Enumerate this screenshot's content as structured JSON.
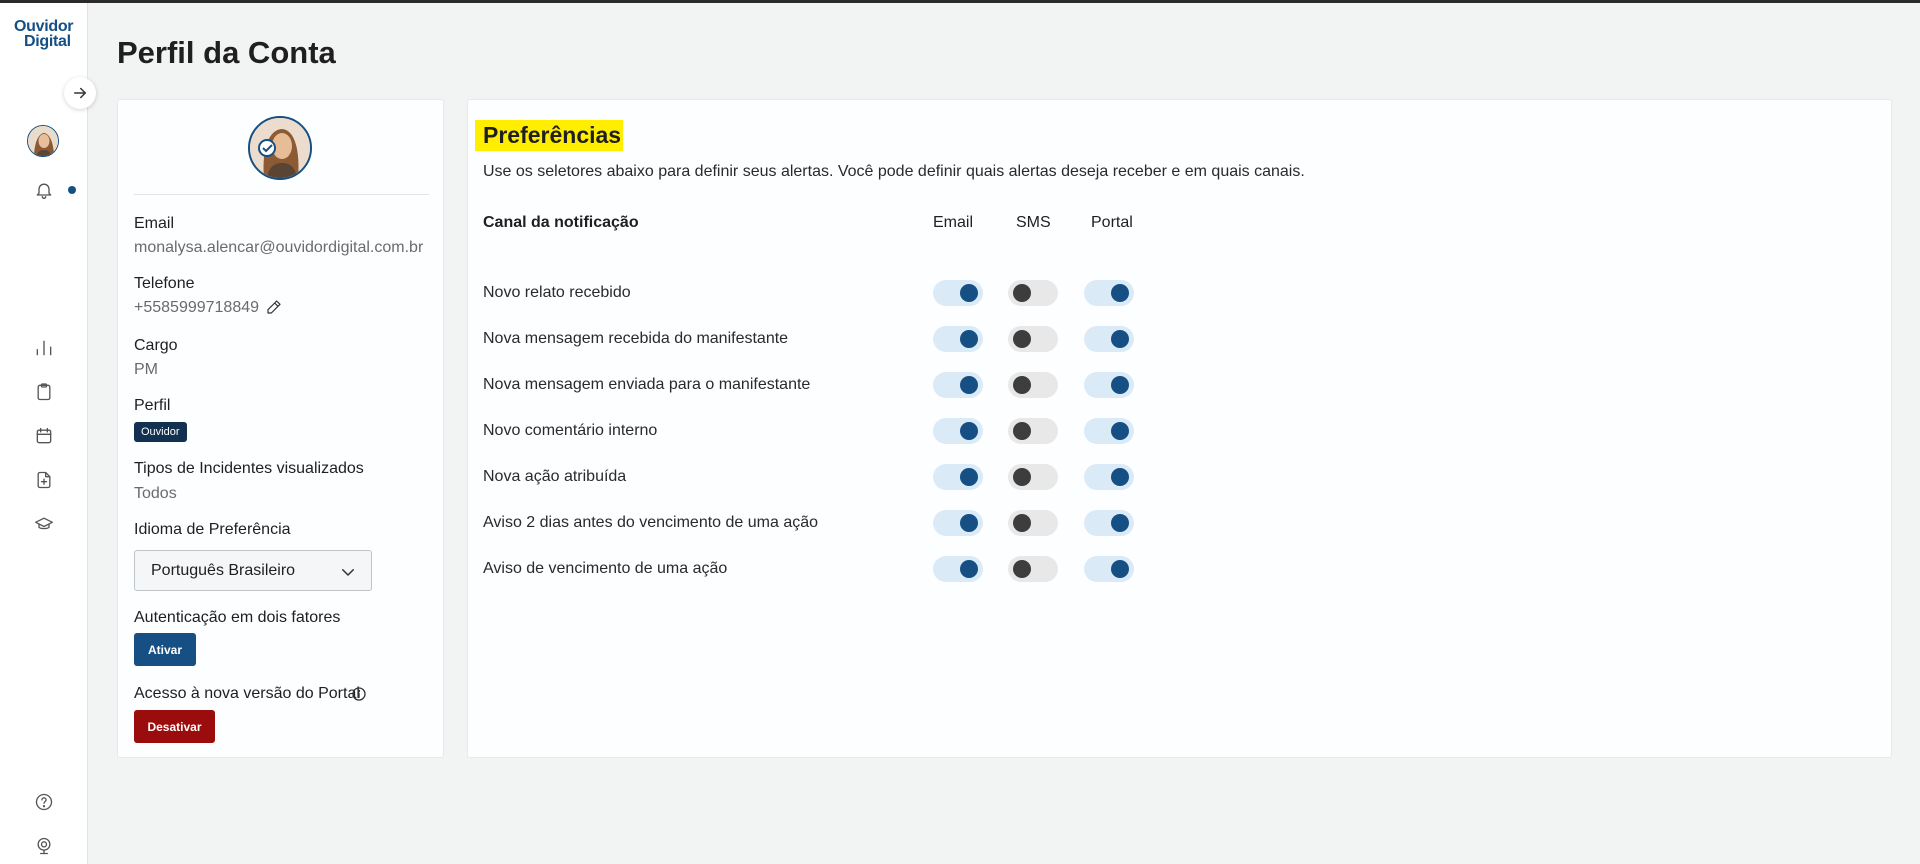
{
  "app": {
    "logo_line1": "Ouvidor",
    "logo_line2": "Digital",
    "brand_color": "#164f84"
  },
  "page": {
    "title": "Perfil da Conta"
  },
  "profile": {
    "email_label": "Email",
    "email_value": "monalysa.alencar@ouvidordigital.com.br",
    "phone_label": "Telefone",
    "phone_value": "+5585999718849",
    "role_label": "Cargo",
    "role_value": "PM",
    "profile_label": "Perfil",
    "profile_badge": "Ouvidor",
    "incident_types_label": "Tipos de Incidentes visualizados",
    "incident_types_value": "Todos",
    "language_label": "Idioma de Preferência",
    "language_value": "Português Brasileiro",
    "two_factor_label": "Autenticação em dois fatores",
    "two_factor_button": "Ativar",
    "portal_access_label": "Acesso à nova versão do Portal",
    "portal_access_button": "Desativar"
  },
  "preferences": {
    "title": "Preferências",
    "description": "Use os seletores abaixo para definir seus alertas. Você pode definir quais alertas deseja receber e em quais canais.",
    "channel_header": "Canal da notificação",
    "columns": [
      "Email",
      "SMS",
      "Portal"
    ],
    "rows": [
      {
        "label": "Novo relato recebido",
        "email": true,
        "sms": false,
        "portal": true
      },
      {
        "label": "Nova mensagem recebida do manifestante",
        "email": true,
        "sms": false,
        "portal": true
      },
      {
        "label": "Nova mensagem enviada para o manifestante",
        "email": true,
        "sms": false,
        "portal": true
      },
      {
        "label": "Novo comentário interno",
        "email": true,
        "sms": false,
        "portal": true
      },
      {
        "label": "Nova ação atribuída",
        "email": true,
        "sms": false,
        "portal": true
      },
      {
        "label": "Aviso 2 dias antes do vencimento de uma ação",
        "email": true,
        "sms": false,
        "portal": true
      },
      {
        "label": "Aviso de vencimento de uma ação",
        "email": true,
        "sms": false,
        "portal": true
      }
    ]
  },
  "sidebar": {
    "icons": [
      "arrow-right-icon",
      "avatar",
      "bell-icon",
      "bar-chart-icon",
      "clipboard-icon",
      "calendar-icon",
      "file-plus-icon",
      "graduation-cap-icon",
      "help-circle-icon",
      "webcam-icon"
    ]
  }
}
